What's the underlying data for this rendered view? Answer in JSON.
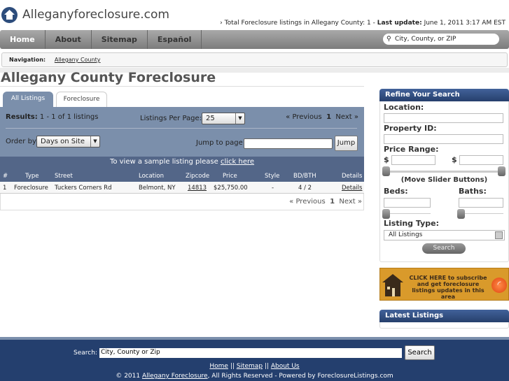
{
  "header": {
    "site_title": "Alleganyforeclosure.com",
    "total_text": "Total Foreclosure listings in Allegany County: 1 - ",
    "last_update_label": "Last update:",
    "last_update_value": " June 1, 2011 3:17 AM EST"
  },
  "nav": {
    "items": [
      "Home",
      "About",
      "Sitemap",
      "Español"
    ],
    "search_placeholder": "City, County, or ZIP"
  },
  "breadcrumb": {
    "label": "Navigation:",
    "link": "Allegany County"
  },
  "page_title": "Allegany County Foreclosure",
  "tabs": [
    "All Listings",
    "Foreclosure"
  ],
  "results": {
    "label": "Results:",
    "value": " 1 - 1 of 1 listings",
    "per_page_label": "Listings Per Page:",
    "per_page": "25",
    "prev": "« Previous",
    "page": "1",
    "next": "Next »",
    "order_label": "Order by",
    "order_value": "Days on Site",
    "jump_label": "Jump to page",
    "jump_button": "Jump"
  },
  "sample": {
    "text": "To view a sample listing please ",
    "link": "click here"
  },
  "table": {
    "headers": [
      "#",
      "Type",
      "Street",
      "Location",
      "Zipcode",
      "Price",
      "Style",
      "BD/BTH",
      "Details"
    ],
    "rows": [
      [
        "1",
        "Foreclosure",
        "Tuckers Corners Rd",
        "Belmont, NY",
        "14813",
        "$25,750.00",
        "-",
        "4 / 2",
        "Details"
      ]
    ]
  },
  "sidebar": {
    "refine_title": "Refine Your Search",
    "location": "Location:",
    "property_id": "Property ID:",
    "price_range": "Price Range:",
    "dollar": "$",
    "slider_hint": "(Move Slider Buttons)",
    "beds": "Beds:",
    "baths": "Baths:",
    "listing_type": "Listing Type:",
    "listing_type_value": "All Listings",
    "search_button": "Search",
    "rss_text": "CLICK HERE to subscribe and get foreclosure listings updates in this area",
    "latest_title": "Latest Listings"
  },
  "footer": {
    "search_label": "Search:",
    "search_value": "City, County or Zip",
    "search_button": "Search",
    "links": [
      "Home",
      "Sitemap",
      "About Us"
    ],
    "sep": " || ",
    "copyright_pre": "© 2011 ",
    "copyright_link": "Allegany Foreclosure",
    "copyright_post": ", All Rights Reserved - Powered by ForeclosureListings.com"
  },
  "colors": {
    "nav_blue": "#243f6e",
    "panel": "#7b8fab",
    "panel_dark": "#536688",
    "rss": "#d99a2b"
  }
}
